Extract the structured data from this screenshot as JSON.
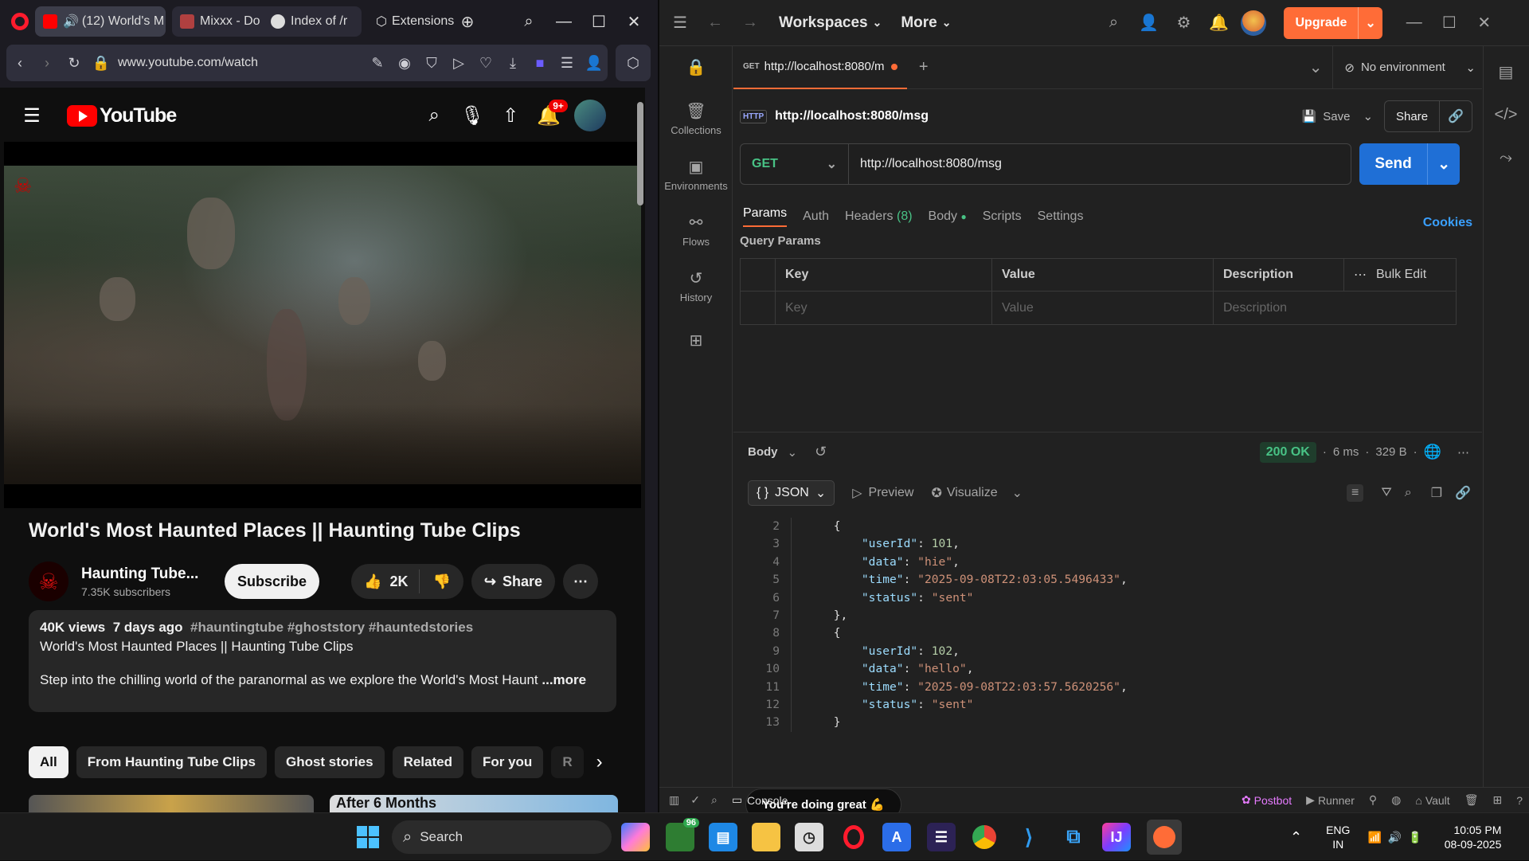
{
  "opera": {
    "tabs": [
      {
        "label": "(12) World's M",
        "color": "#ff0000"
      },
      {
        "label": "Mixxx - Do",
        "color": "#b04040"
      },
      {
        "label": "Index of /r",
        "color": "#dddddd"
      },
      {
        "label": "Extensions",
        "color": "#dddddd"
      }
    ],
    "url": "www.youtube.com/watch"
  },
  "youtube": {
    "logo": "YouTube",
    "notifications": "9+",
    "video_title": "World's Most Haunted Places || Haunting Tube Clips",
    "channel_name": "Haunting Tube...",
    "subscribers": "7.35K subscribers",
    "subscribe_label": "Subscribe",
    "likes": "2K",
    "share_label": "Share",
    "views": "40K views",
    "age": "7 days ago",
    "tags": "#hauntingtube #ghoststory #hauntedstories",
    "desc_line1": "World's Most Haunted Places  || Haunting Tube Clips",
    "desc_line2": "Step into the chilling world of the paranormal as we explore the World's Most Haunt",
    "more": "...more",
    "chips": [
      "All",
      "From Haunting Tube Clips",
      "Ghost stories",
      "Related",
      "For you",
      "R"
    ],
    "next_thumb_text": "After 6 Months"
  },
  "postman": {
    "workspaces": "Workspaces",
    "more": "More",
    "upgrade": "Upgrade",
    "tab_method": "GET",
    "tab_label": "http://localhost:8080/m",
    "environment": "No environment",
    "sidebar": [
      {
        "label": "Collections",
        "icon": "collections-icon"
      },
      {
        "label": "Environments",
        "icon": "environments-icon"
      },
      {
        "label": "Flows",
        "icon": "flows-icon"
      },
      {
        "label": "History",
        "icon": "history-icon"
      }
    ],
    "request_name": "http://localhost:8080/msg",
    "http_badge": "HTTP",
    "save": "Save",
    "share": "Share",
    "method": "GET",
    "url": "http://localhost:8080/msg",
    "send": "Send",
    "tabs": {
      "params": "Params",
      "auth": "Auth",
      "headers": "Headers",
      "headers_count": "(8)",
      "body": "Body",
      "scripts": "Scripts",
      "settings": "Settings"
    },
    "cookies": "Cookies",
    "query_params": "Query Params",
    "table_headers": {
      "key": "Key",
      "value": "Value",
      "description": "Description",
      "bulk_edit": "Bulk Edit"
    },
    "table_placeholders": {
      "key": "Key",
      "value": "Value",
      "description": "Description"
    },
    "response": {
      "label": "Body",
      "status": "200 OK",
      "time": "6 ms",
      "size": "329 B"
    },
    "format": {
      "json": "JSON",
      "preview": "Preview",
      "visualize": "Visualize"
    },
    "code_lines": [
      {
        "n": "2",
        "text": "    {"
      },
      {
        "n": "3",
        "key": "userId",
        "val": "101",
        "type": "num"
      },
      {
        "n": "4",
        "key": "data",
        "val": "\"hie\"",
        "type": "str"
      },
      {
        "n": "5",
        "key": "time",
        "val": "\"2025-09-08T22:03:05.5496433\"",
        "type": "str"
      },
      {
        "n": "6",
        "key": "status",
        "val": "\"sent\"",
        "type": "str",
        "last": true
      },
      {
        "n": "7",
        "text": "    },"
      },
      {
        "n": "8",
        "text": "    {"
      },
      {
        "n": "9",
        "key": "userId",
        "val": "102",
        "type": "num"
      },
      {
        "n": "10",
        "key": "data",
        "val": "\"hello\"",
        "type": "str"
      },
      {
        "n": "11",
        "key": "time",
        "val": "\"2025-09-08T22:03:57.5620256\"",
        "type": "str"
      },
      {
        "n": "12",
        "key": "status",
        "val": "\"sent\"",
        "type": "str",
        "last": true
      },
      {
        "n": "13",
        "text": "    }"
      }
    ],
    "toast": "You're doing great 💪",
    "status_bar": {
      "console": "Console",
      "postbot": "Postbot",
      "runner": "Runner",
      "vault": "Vault"
    }
  },
  "taskbar": {
    "search": "Search",
    "badge": "96",
    "lang": "ENG",
    "region": "IN",
    "time": "10:05 PM",
    "date": "08-09-2025"
  }
}
